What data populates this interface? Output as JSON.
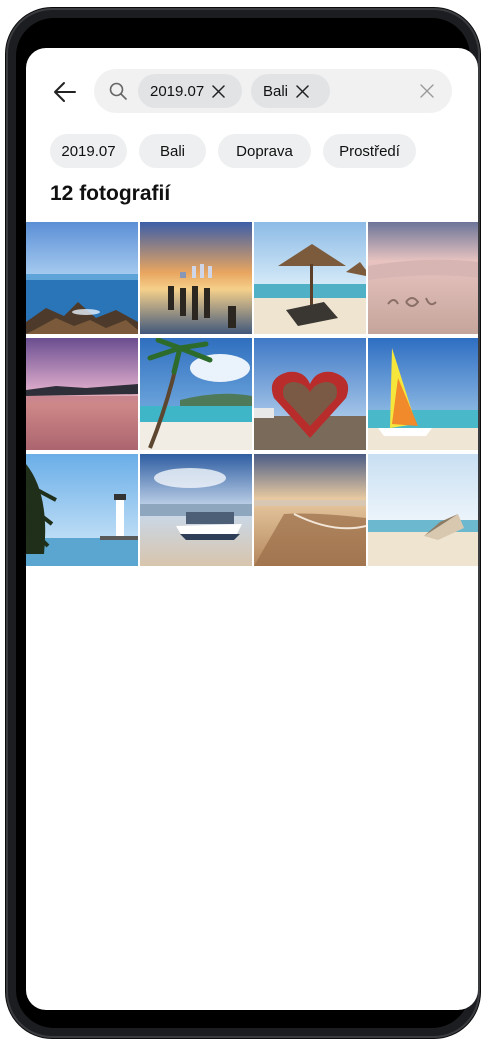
{
  "search": {
    "chips": [
      "2019.07",
      "Bali"
    ]
  },
  "suggestions": [
    "2019.07",
    "Bali",
    "Doprava",
    "Prostředí"
  ],
  "results": {
    "count_label": "12 fotografií"
  },
  "photos": [
    "ocean-rocks",
    "pier-sunset",
    "beach-umbrella",
    "sand-love",
    "purple-sunset",
    "palm-beach",
    "heart-sculpture",
    "sailboat",
    "lighthouse",
    "boat-on-beach",
    "golden-shore",
    "beached-boat"
  ],
  "colors": {
    "background": "#ffffff",
    "chip": "#eeeff0",
    "selected_chip": "#e2e3e5",
    "search_bar": "#f1f1f2",
    "text": "#111111"
  }
}
